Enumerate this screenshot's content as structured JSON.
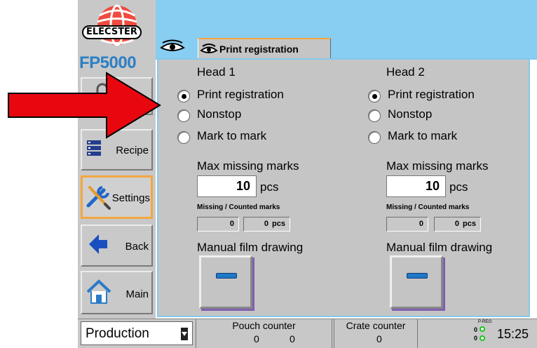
{
  "app": {
    "brand": "ELECSTER",
    "model": "FP5000"
  },
  "nav": {
    "items": [
      {
        "label": "",
        "icon": "lock-icon"
      },
      {
        "label": "Recipe",
        "icon": "list-icon"
      },
      {
        "label": "Settings",
        "icon": "wrench-screwdriver-icon",
        "active": true
      },
      {
        "label": "Back",
        "icon": "arrow-left-icon"
      },
      {
        "label": "Main",
        "icon": "home-icon"
      }
    ]
  },
  "tab": {
    "label": "Print registration",
    "icon": "eye-icon"
  },
  "heads": [
    {
      "title": "Head 1",
      "options": [
        "Print registration",
        "Nonstop",
        "Mark to mark"
      ],
      "selected": "Print registration",
      "max_missing_label": "Max missing marks",
      "max_missing_value": "10",
      "unit": "pcs",
      "missing_counted_label": "Missing / Counted marks",
      "missing": "0",
      "counted": "0",
      "counted_unit": "pcs",
      "manual_label": "Manual film drawing"
    },
    {
      "title": "Head 2",
      "options": [
        "Print registration",
        "Nonstop",
        "Mark to mark"
      ],
      "selected": "Print registration",
      "max_missing_label": "Max missing marks",
      "max_missing_value": "10",
      "unit": "pcs",
      "missing_counted_label": "Missing / Counted marks",
      "missing": "0",
      "counted": "0",
      "counted_unit": "pcs",
      "manual_label": "Manual film drawing"
    }
  ],
  "bottom": {
    "mode": "Production",
    "pouch_label": "Pouch counter",
    "pouch_a": "0",
    "pouch_b": "0",
    "crate_label": "Crate counter",
    "crate_value": "0",
    "preg_label": "P-REG:",
    "preg_v1": "0",
    "preg_v2": "0",
    "time": "15:25"
  },
  "colors": {
    "accent": "#f3a640",
    "sky": "#87cef2",
    "panel": "#c5c5c5",
    "arrow": "#e8070f"
  }
}
